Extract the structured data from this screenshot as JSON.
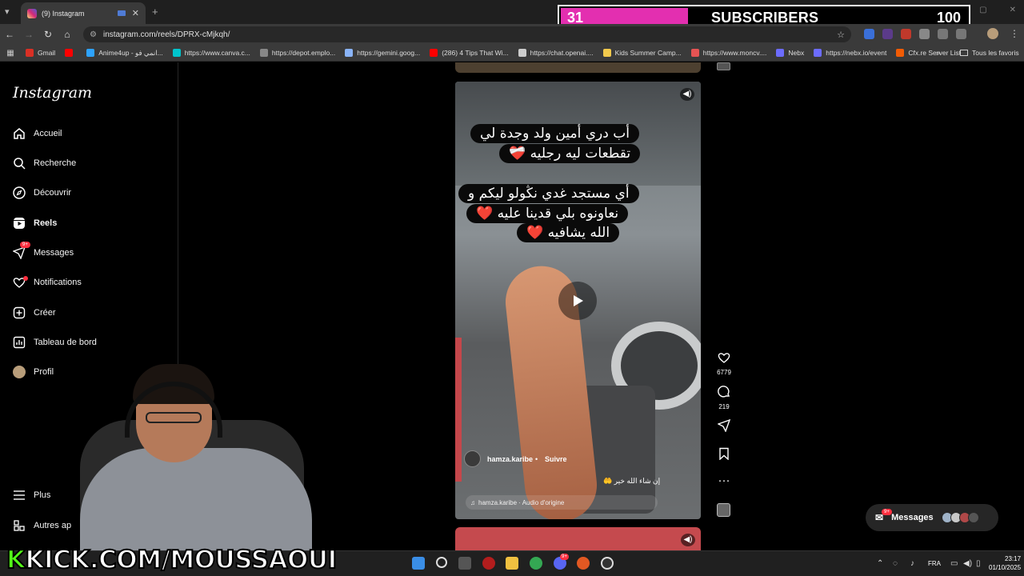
{
  "browser": {
    "tab_title": "(9) Instagram",
    "url": "instagram.com/reels/DPRX-cMjkqh/",
    "new_tab_icon": "+",
    "close_icon": "✕",
    "bookmarks": [
      {
        "label": "Gmail",
        "color": "#d93025"
      },
      {
        "label": "",
        "color": "#ff0000"
      },
      {
        "label": "Anime4up - انمي فو...",
        "color": "#2ea3ff"
      },
      {
        "label": "https://www.canva.c...",
        "color": "#00c4cc"
      },
      {
        "label": "https://depot.emplo...",
        "color": "#888888"
      },
      {
        "label": "https://gemini.goog...",
        "color": "#8ab4f8"
      },
      {
        "label": "(286) 4 Tips That Wi...",
        "color": "#ff0000"
      },
      {
        "label": "https://chat.openai....",
        "color": "#cccccc"
      },
      {
        "label": "Kids Summer Camp...",
        "color": "#f2c94c"
      },
      {
        "label": "https://www.moncv....",
        "color": "#e55353"
      },
      {
        "label": "Nebx",
        "color": "#6c6cff"
      },
      {
        "label": "https://nebx.io/event",
        "color": "#6c6cff"
      },
      {
        "label": "Cfx.re Server List",
        "color": "#f25c05"
      }
    ],
    "bookmarks_all": "Tous les favoris"
  },
  "overlay": {
    "subscribers_current": "31",
    "subscribers_label": "SUBSCRIBERS",
    "subscribers_goal": "100",
    "subscribers_progress": 0.31,
    "kick_prefix": "K",
    "kick_rest": "KICK.COM/MOUSSAOUI"
  },
  "instagram": {
    "logo": "Instagram",
    "nav": [
      {
        "label": "Accueil",
        "icon": "home-icon"
      },
      {
        "label": "Recherche",
        "icon": "search-icon"
      },
      {
        "label": "Découvrir",
        "icon": "explore-icon"
      },
      {
        "label": "Reels",
        "icon": "reels-icon"
      },
      {
        "label": "Messages",
        "icon": "messages-icon",
        "badge": "9+"
      },
      {
        "label": "Notifications",
        "icon": "heart-icon"
      },
      {
        "label": "Créer",
        "icon": "create-icon"
      },
      {
        "label": "Tableau de bord",
        "icon": "dashboard-icon"
      },
      {
        "label": "Profil",
        "icon": "profile-avatar"
      }
    ],
    "more": "Plus",
    "others": "Autres ap",
    "reel": {
      "caption_1_line1": "أب دري أمين ولد وجدة لي",
      "caption_1_line2": "تقطعات ليه رجليه ❤️‍🩹",
      "caption_2_line1": "أي مستجد غدي نڭولو ليكم و",
      "caption_2_line2": "نعاونوه بلي قدينا عليه ❤️",
      "caption_2_line3": "الله يشافيه ❤️",
      "author": "hamza.karibe",
      "separator": "•",
      "follow": "Suivre",
      "text": "إن شاء الله خير 🤲",
      "audio": "hamza.karibe · Audio d'origine"
    },
    "likes": "6779",
    "comments": "219",
    "messages_pill": "Messages",
    "messages_badge": "9+"
  },
  "taskbar": {
    "lang": "FRA",
    "time": "23:17",
    "date": "01/10/2025",
    "app_badge": "9+"
  }
}
